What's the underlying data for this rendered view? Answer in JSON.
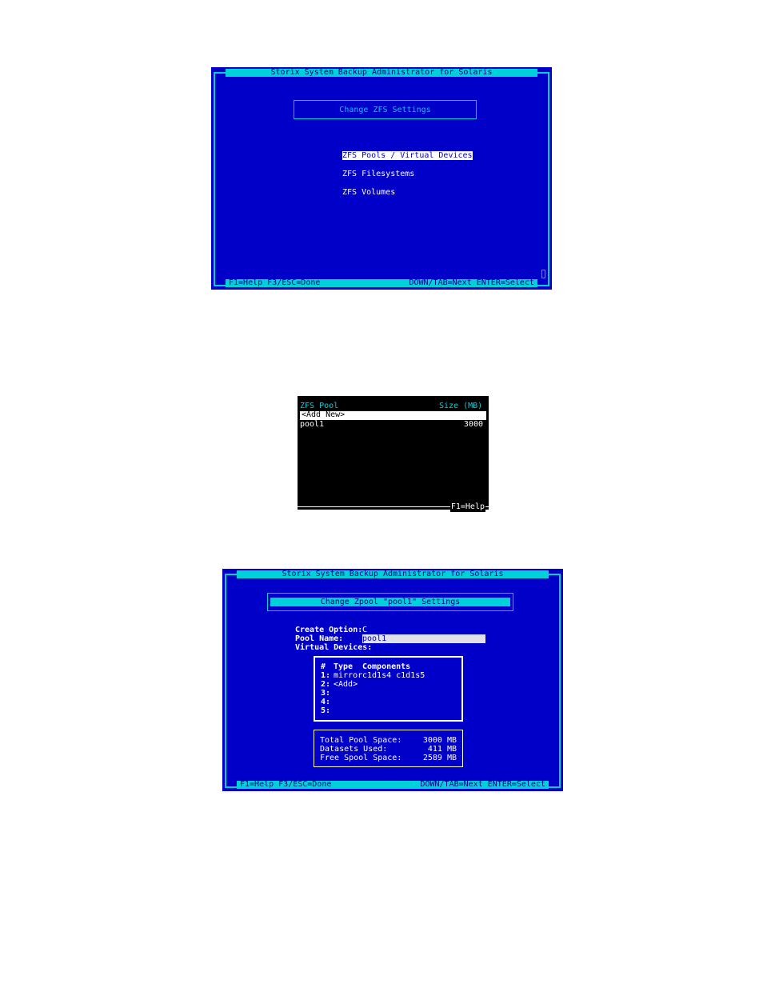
{
  "screen1": {
    "title": "Storix System Backup Administrator for Solaris",
    "subtitle": "Change ZFS Settings",
    "menu": [
      "ZFS Pools / Virtual Devices",
      "ZFS Filesystems",
      "ZFS Volumes"
    ],
    "footer_left": "F1=Help  F3/ESC=Done",
    "footer_right": "DOWN/TAB=Next  ENTER=Select"
  },
  "screen2": {
    "col_pool": "ZFS Pool",
    "col_size": "Size (MB)",
    "rows": [
      {
        "name": "<Add New>",
        "size": ""
      },
      {
        "name": "pool1",
        "size": "3000"
      }
    ],
    "footer": "F1=Help"
  },
  "screen3": {
    "title": "Storix System Backup Administrator for Solaris",
    "subtitle": "Change Zpool \"pool1\" Settings",
    "create_option_label": "Create Option:",
    "create_option_value": "C",
    "pool_name_label": "Pool Name:",
    "pool_name_value": "pool1",
    "virtual_devices_label": "Virtual Devices:",
    "vdev_header": {
      "num": "#",
      "type": "Type",
      "components": "Components"
    },
    "vdevs": [
      {
        "num": "1:",
        "type": "mirror",
        "components": "c1d1s4 c1d1s5"
      },
      {
        "num": "2:",
        "type": "<Add>",
        "components": ""
      },
      {
        "num": "3:",
        "type": "",
        "components": ""
      },
      {
        "num": "4:",
        "type": "",
        "components": ""
      },
      {
        "num": "5:",
        "type": "",
        "components": ""
      }
    ],
    "summary": [
      {
        "label": "Total Pool Space:",
        "value": "3000 MB"
      },
      {
        "label": "Datasets Used:",
        "value": "411 MB"
      },
      {
        "label": "Free Spool Space:",
        "value": "2589 MB"
      }
    ],
    "footer_left": "F1=Help  F3/ESC=Done",
    "footer_right": "DOWN/TAB=Next  ENTER=Select"
  }
}
